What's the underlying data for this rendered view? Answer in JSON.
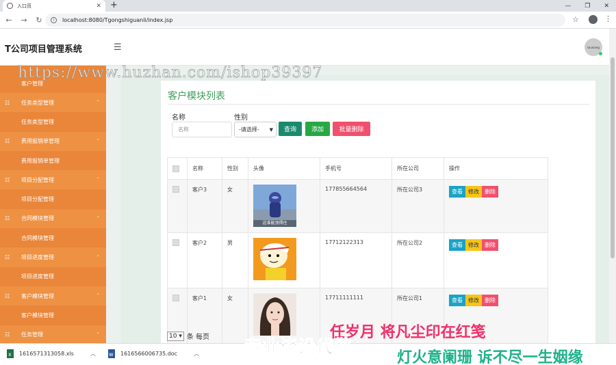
{
  "browser": {
    "tab_title": "入口页",
    "new_tab": "+",
    "url": "localhost:8080/Tgongshiguanli/index.jsp"
  },
  "app": {
    "title": "T公司项目管理系统",
    "avatar_text": "touxiang"
  },
  "sidebar": {
    "partial_top": "客户管理",
    "items": [
      {
        "label": "任务类型管理",
        "type": "head"
      },
      {
        "label": "任务类型管理",
        "type": "sub"
      },
      {
        "label": "费用报销单管理",
        "type": "head"
      },
      {
        "label": "费用报销单管理",
        "type": "sub"
      },
      {
        "label": "项目分配管理",
        "type": "head"
      },
      {
        "label": "项目分配管理",
        "type": "sub"
      },
      {
        "label": "合同模块管理",
        "type": "head"
      },
      {
        "label": "合同模块管理",
        "type": "sub"
      },
      {
        "label": "项目进度管理",
        "type": "head"
      },
      {
        "label": "项目进度管理",
        "type": "sub"
      },
      {
        "label": "客户模块管理",
        "type": "head"
      },
      {
        "label": "客户模块管理",
        "type": "sub"
      },
      {
        "label": "任务管理",
        "type": "head"
      }
    ]
  },
  "main": {
    "title": "客户模块列表",
    "filter": {
      "name_label": "名称",
      "name_placeholder": "名称",
      "gender_label": "性别",
      "gender_selected": "-请选择-",
      "query_btn": "查询",
      "add_btn": "添加",
      "batch_delete_btn": "批量删除"
    },
    "table": {
      "headers": [
        "",
        "名称",
        "性别",
        "头像",
        "手机号",
        "所在公司",
        "操作"
      ],
      "rows": [
        {
          "name": "客户3",
          "gender": "女",
          "phone": "177855664564",
          "company": "所在公司3",
          "avatar_caption": "这谁能顶得住"
        },
        {
          "name": "客户2",
          "gender": "男",
          "phone": "17712122313",
          "company": "所在公司2",
          "avatar_caption": ""
        },
        {
          "name": "客户1",
          "gender": "女",
          "phone": "17711111111",
          "company": "所在公司1",
          "avatar_caption": ""
        }
      ],
      "actions": {
        "view": "查看",
        "edit": "修改",
        "delete": "删除"
      }
    },
    "pager": {
      "page_size": "10",
      "suffix": "条 每页"
    }
  },
  "downloads": [
    {
      "file": "1616571313058.xls"
    },
    {
      "file": "1616566006735.doc"
    }
  ],
  "watermarks": {
    "url": "https://www.huzhan.com/ishop39397",
    "line1": "任岁月 将凡尘印在红笺",
    "line2": "专业毕设代做",
    "line3": "灯火意阑珊 诉不尽一生姻缘"
  },
  "colors": {
    "sidebar": "#f2994a",
    "title_green": "#3f9e5a",
    "query": "#1a8a6e",
    "add": "#28a745",
    "delete": "#f0506e",
    "view": "#1aa3c6",
    "edit": "#f5c518"
  }
}
